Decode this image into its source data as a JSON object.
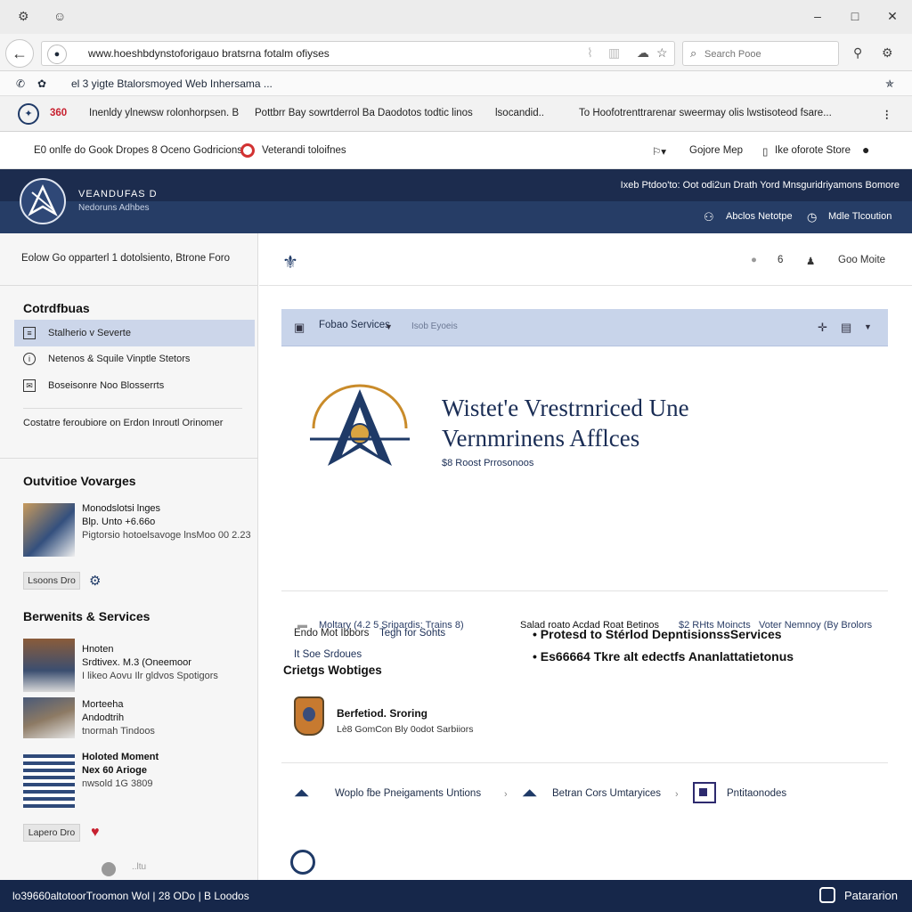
{
  "browser": {
    "title_icons": [
      "settings-icon",
      "user-icon"
    ],
    "url": "www.hoeshbdynstoforigauo bratsrna fotalm ofiyses",
    "search_placeholder": "Search Pooe",
    "bookmark_text": "el 3 yigte Btalorsmoyed Web Inhersama ...",
    "window_controls": [
      "–",
      "□",
      "✕"
    ]
  },
  "tabs": {
    "badge": "360",
    "items": [
      "Inenldy ylnewsw rolonhorpsen. B",
      "Pottbrr Bay sowrtderrol Ba Daodotos todtic linos",
      "lsocandid..",
      "To Hoofotrenttrarenar sweermay olis lwstisoteod fsare..."
    ]
  },
  "utility": {
    "left": "E0 onlfe do Gook Dropes 8 Oceno Godricions",
    "center": "Veterandi toloifnes",
    "right1": "Gojore Mep",
    "right2": "Ike oforote Store"
  },
  "brand": {
    "agency": "VEANDUFAS D",
    "subtag": "Nedoruns Adhbes",
    "toplinks": "Ixeb Ptdoo'to: Oot odi2un Drath Yord Mnsguridriyamons  Bomore",
    "link1": "Abclos Netotpe",
    "link2": "Mdle Tlcoution"
  },
  "sidebar": {
    "notice": "Eolow Go opparterl 1 dotolsiento, Btrone Foro",
    "section1_title": "Cotrdfbuas",
    "nav": [
      {
        "label": "Stalherio v Severte",
        "icon": "document-icon",
        "active": true
      },
      {
        "label": "Netenos & Squile Vinptle Stetors",
        "icon": "info-icon",
        "active": false
      },
      {
        "label": "Boseisonre Noo Blosserrts",
        "icon": "mail-icon",
        "active": false
      }
    ],
    "contact": "Costatre feroubiore on Erdon Inroutl Orinomer",
    "section2_title": "Outvitioe Vovarges",
    "news1": {
      "title": "Monodslotsi lnges",
      "line2": "Blp. Unto +6.66o",
      "meta": "Pigtorsio hotoelsavoge lnsMoo 00 2.23"
    },
    "more1": "Lsoons Dro",
    "section3_title": "Berwenits & Services",
    "news2": {
      "title": "Hnoten",
      "line2": "Srdtivex. M.3 (Oneemoor",
      "meta": "I likeo Aovu Ilr gldvos Spotigors"
    },
    "news3": {
      "title": "Morteeha",
      "line2": "Andodtrih",
      "meta": "tnormah Tindoos"
    },
    "news4": {
      "title": "Holoted Moment",
      "line2": "Nex 60 Arioge",
      "meta": "nwsold 1G 3809"
    },
    "more2": "Lapero Dro",
    "footer_tiny": "..ltu"
  },
  "main": {
    "top_count": "6",
    "top_link": "Goo Moite",
    "panel_label": "Fobao Services",
    "panel_sub": "Isob Eyoeis",
    "heading_line1": "Wistet'e Vrestrnriced Une",
    "heading_line2": "Vernmrinens Afflces",
    "heading_sub": "$8  Roost Prrosonoos",
    "left_row1_a": "Endo Mot Ibbors",
    "left_row1_b": "Tegh for Sohts",
    "left_row2": "It  Soe Srdoues",
    "bullet1": "•  Protesd to Stérlod DepntisionssServices",
    "bullet2": "•  Es66664 Tkre alt edectfs Ananlattatietonus",
    "filter1": "Moltary (4.2 5 Sripardis: Trains  8)",
    "filter2": "Salad roato Acdad Roat Betinos",
    "filter3": "$2  RHts  Moincts",
    "filter4": "Voter Nemnoy (By Brolors",
    "section_title": "Crietgs Wobtiges",
    "feature_title": "Berfetiod. Sroring",
    "feature_sub": "Lè8 GomCon Bly 0odot Sarbiiors",
    "services": [
      "Woplo fbe Pneigaments Untions",
      "Betran Cors Umtaryices",
      "Pntitaonodes"
    ]
  },
  "footer": {
    "left": "lo39660altotoorTroomon Wol  |  28 ODo  |  B Loodos",
    "right": "Patararion"
  },
  "colors": {
    "navy": "#1c2c4e",
    "accent_band": "#263d66",
    "panel": "#c8d4ea",
    "active_nav": "#ccd6ea",
    "alert_red": "#d23232"
  }
}
